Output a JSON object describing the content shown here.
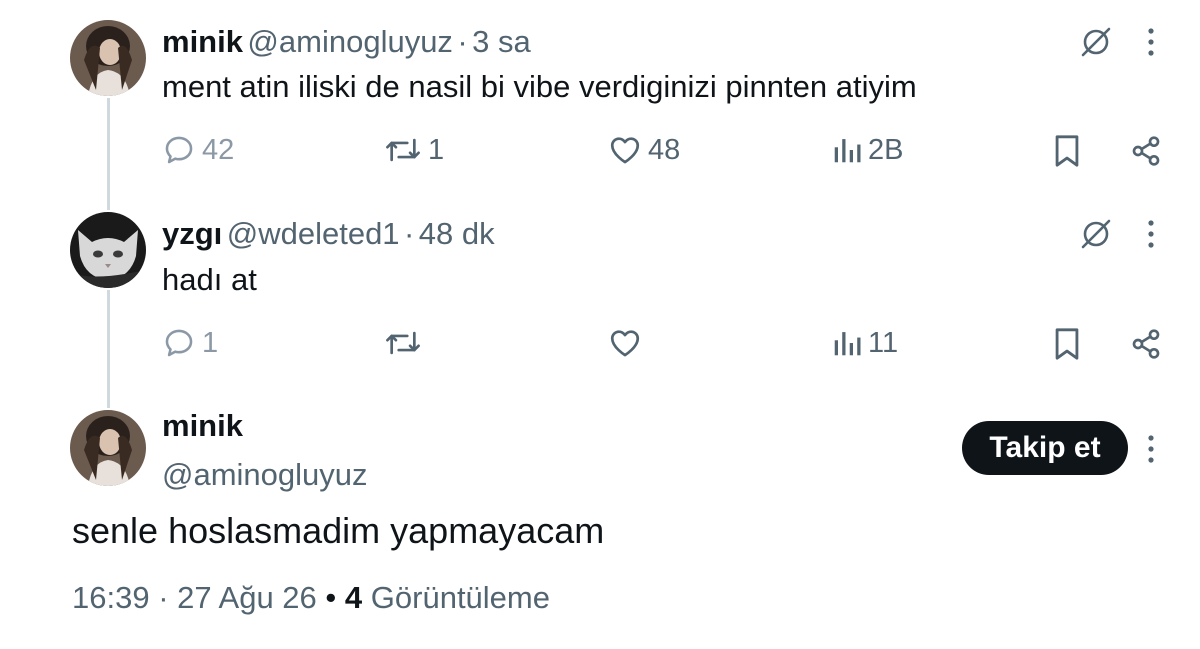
{
  "tweets": [
    {
      "name": "minik",
      "handle": "@aminogluyuz",
      "sep": "·",
      "time": "3 sa",
      "text": "ment atin iliski de nasil bi vibe verdiginizi pinnten atiyim",
      "replies": "42",
      "retweets": "1",
      "likes": "48",
      "views": "2B"
    },
    {
      "name": "yzgı",
      "handle": "@wdeleted1",
      "sep": "·",
      "time": "48 dk",
      "text": "hadı at",
      "replies": "1",
      "retweets": "",
      "likes": "",
      "views": "11"
    }
  ],
  "main_tweet": {
    "name": "minik",
    "handle": "@aminogluyuz",
    "follow_label": "Takip et",
    "text": "senle hoslasmadim yapmayacam",
    "time": "16:39",
    "date": "27 Ağu 26",
    "dot1": "·",
    "dot2": "•",
    "views_count": "4",
    "views_label": "Görüntüleme"
  },
  "colors": {
    "text": "#0f1419",
    "secondary": "#536471",
    "thread_line": "#cfd9de",
    "button_bg": "#0f1419"
  },
  "icons": [
    "reply-icon",
    "retweet-icon",
    "like-icon",
    "views-icon",
    "bookmark-icon",
    "share-icon",
    "grok-icon",
    "more-icon"
  ]
}
